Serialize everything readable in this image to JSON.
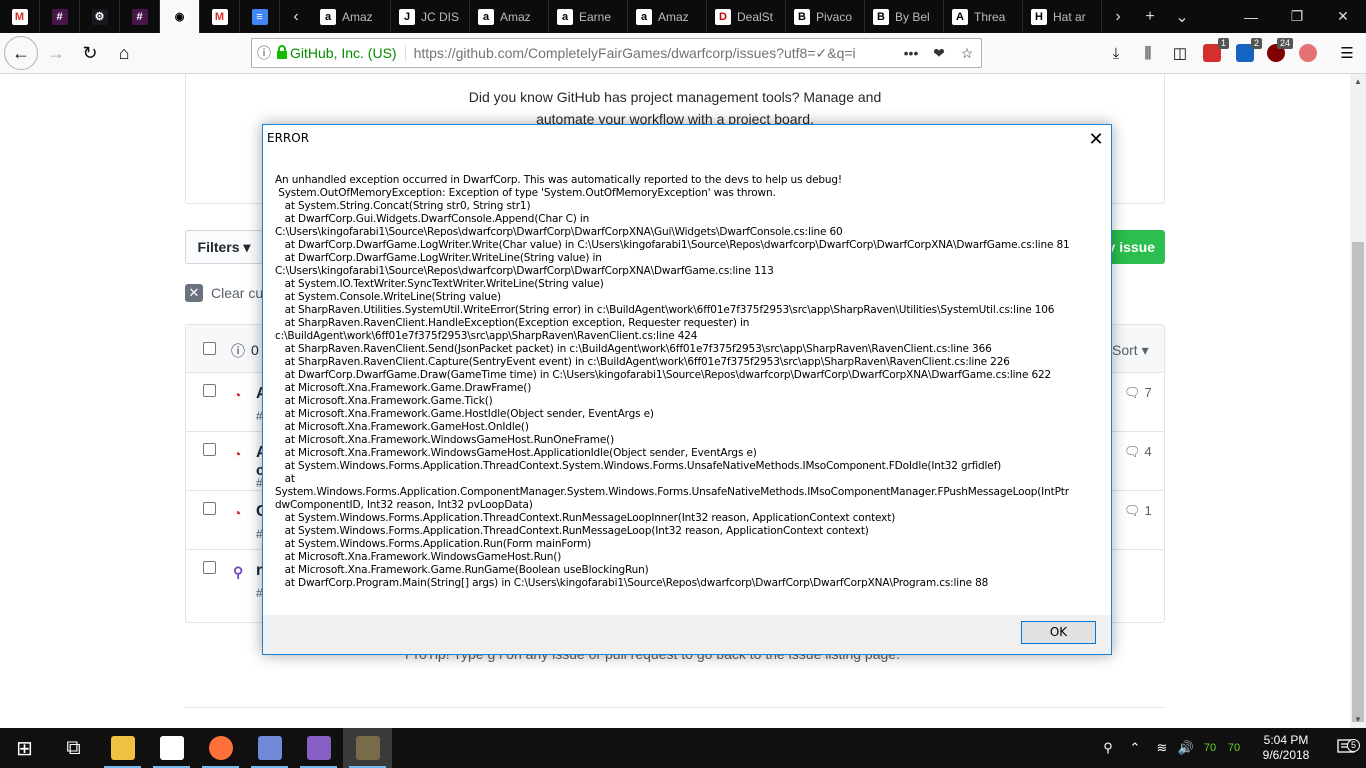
{
  "browser": {
    "tabs": [
      {
        "icon": "gmail-icon",
        "glyph": "M",
        "label": ""
      },
      {
        "icon": "slack-icon",
        "glyph": "#",
        "label": ""
      },
      {
        "icon": "steam-icon",
        "glyph": "⚙",
        "label": ""
      },
      {
        "icon": "slack-icon",
        "glyph": "#",
        "label": ""
      },
      {
        "icon": "github-icon",
        "glyph": "◉",
        "label": "",
        "active": true
      },
      {
        "icon": "gmail-icon",
        "glyph": "M",
        "label": ""
      },
      {
        "icon": "docs-icon",
        "glyph": "≡",
        "label": ""
      }
    ],
    "wide_tabs": [
      {
        "icon": "amazon-icon",
        "glyph": "a",
        "label": "Amaz"
      },
      {
        "icon": "jcdisc-icon",
        "glyph": "J",
        "label": "JC DIS"
      },
      {
        "icon": "amazon-icon",
        "glyph": "a",
        "label": "Amaz"
      },
      {
        "icon": "amazon-icon",
        "glyph": "a",
        "label": "Earne"
      },
      {
        "icon": "amazon-icon",
        "glyph": "a",
        "label": "Amaz"
      },
      {
        "icon": "dealst-icon",
        "glyph": "D",
        "label": "DealSt"
      },
      {
        "icon": "bookmark-icon",
        "glyph": "B",
        "label": "Pivaco"
      },
      {
        "icon": "bookmark-icon",
        "glyph": "B",
        "label": "By Bel"
      },
      {
        "icon": "atlas-icon",
        "glyph": "A",
        "label": "Threa"
      },
      {
        "icon": "hat-icon",
        "glyph": "H",
        "label": "Hat ar"
      }
    ],
    "tab_overflow_left": "‹",
    "tab_overflow_right": "›",
    "new_tab": "+",
    "tab_list": "⌄",
    "win_minimize": "—",
    "win_restore": "❐",
    "win_close": "✕",
    "nav": {
      "back": "←",
      "forward": "→",
      "reload": "↻",
      "home": "⌂"
    },
    "url": {
      "info": "ⓘ",
      "lock": "🔒",
      "org": "GitHub, Inc. (US)",
      "prefix": "https://github.com/",
      "path": "CompletelyFairGames/dwarfcorp/issues?utf8=✓&q=i",
      "actions": "•••",
      "pocket": "❤",
      "star": "☆"
    },
    "toolbar": {
      "download": "⤓",
      "library": "⫼",
      "sidebar": "◫",
      "ext1_badge": "1",
      "ext2_badge": "2",
      "ext3_badge": "24",
      "menu": "☰"
    }
  },
  "page": {
    "promo_line1": "Did you know GitHub has project management tools? Manage and",
    "promo_line2": "automate your workflow with a project board.",
    "filters_label": "Filters ▾",
    "new_issue_label": "v issue",
    "clear_label": "Clear cu",
    "clear_icon": "✕",
    "header_open_icon": "ⓘ",
    "header_open_count": "0",
    "sort_label": "Sort ▾",
    "rows": [
      {
        "icon": "◔",
        "title": "A",
        "number": "#",
        "comments": "7"
      },
      {
        "icon": "◔",
        "title": "A",
        "number": "#",
        "extra": "c",
        "comments": "4"
      },
      {
        "icon": "◔",
        "title": "C",
        "number": "#",
        "comments": "1"
      },
      {
        "icon": "⚲",
        "title": "re",
        "number": "#6",
        "comments": ""
      }
    ],
    "comment_icon": "🗨",
    "protip": "ProTip! Type  g  i  on any issue or pull request to go back to the issue listing page."
  },
  "dialog": {
    "title": "ERROR",
    "close": "✕",
    "message": "An unhandled exception occurred in DwarfCorp. This was automatically reported to the devs to help us debug!\n System.OutOfMemoryException: Exception of type 'System.OutOfMemoryException' was thrown.\n   at System.String.Concat(String str0, String str1)\n   at DwarfCorp.Gui.Widgets.DwarfConsole.Append(Char C) in\nC:\\Users\\kingofarabi1\\Source\\Repos\\dwarfcorp\\DwarfCorp\\DwarfCorpXNA\\Gui\\Widgets\\DwarfConsole.cs:line 60\n   at DwarfCorp.DwarfGame.LogWriter.Write(Char value) in C:\\Users\\kingofarabi1\\Source\\Repos\\dwarfcorp\\DwarfCorp\\DwarfCorpXNA\\DwarfGame.cs:line 81\n   at DwarfCorp.DwarfGame.LogWriter.WriteLine(String value) in\nC:\\Users\\kingofarabi1\\Source\\Repos\\dwarfcorp\\DwarfCorp\\DwarfCorpXNA\\DwarfGame.cs:line 113\n   at System.IO.TextWriter.SyncTextWriter.WriteLine(String value)\n   at System.Console.WriteLine(String value)\n   at SharpRaven.Utilities.SystemUtil.WriteError(String error) in c:\\BuildAgent\\work\\6ff01e7f375f2953\\src\\app\\SharpRaven\\Utilities\\SystemUtil.cs:line 106\n   at SharpRaven.RavenClient.HandleException(Exception exception, Requester requester) in\nc:\\BuildAgent\\work\\6ff01e7f375f2953\\src\\app\\SharpRaven\\RavenClient.cs:line 424\n   at SharpRaven.RavenClient.Send(JsonPacket packet) in c:\\BuildAgent\\work\\6ff01e7f375f2953\\src\\app\\SharpRaven\\RavenClient.cs:line 366\n   at SharpRaven.RavenClient.Capture(SentryEvent event) in c:\\BuildAgent\\work\\6ff01e7f375f2953\\src\\app\\SharpRaven\\RavenClient.cs:line 226\n   at DwarfCorp.DwarfGame.Draw(GameTime time) in C:\\Users\\kingofarabi1\\Source\\Repos\\dwarfcorp\\DwarfCorp\\DwarfCorpXNA\\DwarfGame.cs:line 622\n   at Microsoft.Xna.Framework.Game.DrawFrame()\n   at Microsoft.Xna.Framework.Game.Tick()\n   at Microsoft.Xna.Framework.Game.HostIdle(Object sender, EventArgs e)\n   at Microsoft.Xna.Framework.GameHost.OnIdle()\n   at Microsoft.Xna.Framework.WindowsGameHost.RunOneFrame()\n   at Microsoft.Xna.Framework.WindowsGameHost.ApplicationIdle(Object sender, EventArgs e)\n   at System.Windows.Forms.Application.ThreadContext.System.Windows.Forms.UnsafeNativeMethods.IMsoComponent.FDoIdle(Int32 grfidlef)\n   at\nSystem.Windows.Forms.Application.ComponentManager.System.Windows.Forms.UnsafeNativeMethods.IMsoComponentManager.FPushMessageLoop(IntPtr\ndwComponentID, Int32 reason, Int32 pvLoopData)\n   at System.Windows.Forms.Application.ThreadContext.RunMessageLoopInner(Int32 reason, ApplicationContext context)\n   at System.Windows.Forms.Application.ThreadContext.RunMessageLoop(Int32 reason, ApplicationContext context)\n   at System.Windows.Forms.Application.Run(Form mainForm)\n   at Microsoft.Xna.Framework.WindowsGameHost.Run()\n   at Microsoft.Xna.Framework.Game.RunGame(Boolean useBlockingRun)\n   at DwarfCorp.Program.Main(String[] args) in C:\\Users\\kingofarabi1\\Source\\Repos\\dwarfcorp\\DwarfCorp\\DwarfCorpXNA\\Program.cs:line 88",
    "ok_label": "OK"
  },
  "taskbar": {
    "items": [
      {
        "name": "start-button",
        "glyph": "⊞",
        "color": "#ffffff"
      },
      {
        "name": "task-view-button",
        "glyph": "⧉",
        "color": "#ffffff"
      },
      {
        "name": "file-explorer-button",
        "glyph": "",
        "color": "#f0c040"
      },
      {
        "name": "notepad-button",
        "glyph": "",
        "color": "#ffffff"
      },
      {
        "name": "firefox-button",
        "glyph": "",
        "color": "#ff7139"
      },
      {
        "name": "discord-button",
        "glyph": "",
        "color": "#7289da"
      },
      {
        "name": "visual-studio-button",
        "glyph": "",
        "color": "#865fc5"
      },
      {
        "name": "dwarfcorp-button",
        "glyph": "",
        "color": "#7a6a4a"
      }
    ],
    "tray": {
      "people": "⚲",
      "chevron": "⌃",
      "wifi": "≋",
      "volume": "🔊",
      "temp1": "70",
      "temp2": "70",
      "time": "5:04 PM",
      "date": "9/6/2018",
      "notifications": "5"
    }
  }
}
